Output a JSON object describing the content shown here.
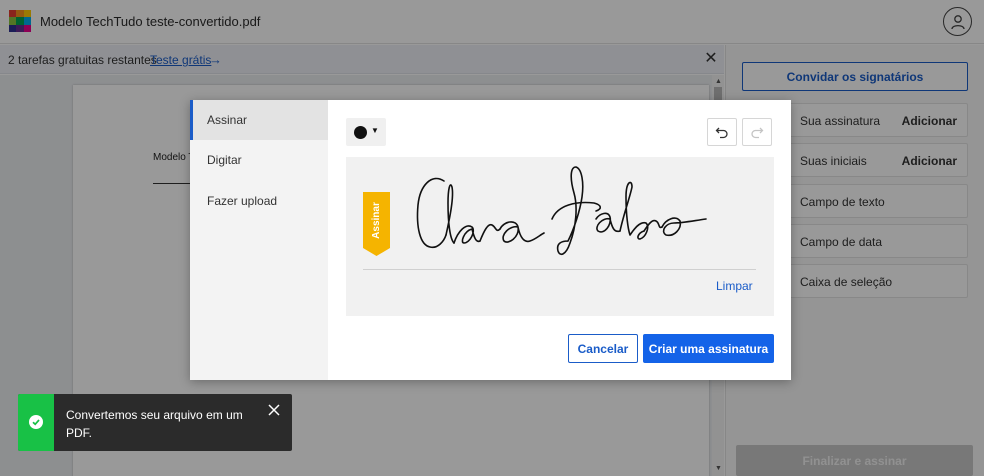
{
  "app": {
    "title": "Modelo TechTudo teste-convertido.pdf",
    "logo_colors": [
      "#e63c2f",
      "#f7941d",
      "#ffcb05",
      "#8bc53f",
      "#00a651",
      "#00aeef",
      "#2e3192",
      "#662d91",
      "#ec008c"
    ]
  },
  "infobar": {
    "tasks_text": "2 tarefas gratuitas restantes",
    "trial_link": "Teste grátis",
    "arrow": "→",
    "close": "✕"
  },
  "document": {
    "label_visible": "Modelo T"
  },
  "right_panel": {
    "invite_label": "Convidar os signatários",
    "fields": [
      {
        "label": "Sua assinatura",
        "action": "Adicionar"
      },
      {
        "label": "Suas iniciais",
        "action": "Adicionar"
      },
      {
        "label": "Campo de texto",
        "action": ""
      },
      {
        "label": "Campo de data",
        "action": ""
      },
      {
        "label": "Caixa de seleção",
        "action": ""
      }
    ],
    "finalize_label": "Finalizar e assinar"
  },
  "modal": {
    "tabs": [
      {
        "label": "Assinar",
        "active": true
      },
      {
        "label": "Digitar",
        "active": false
      },
      {
        "label": "Fazer upload",
        "active": false
      }
    ],
    "pen_color": "#111111",
    "badge_label": "Assinar",
    "badge_color": "#f5b400",
    "clear_label": "Limpar",
    "cancel_label": "Cancelar",
    "create_label": "Criar uma assinatura"
  },
  "toast": {
    "message": "Convertemos seu arquivo em um PDF.",
    "accent_color": "#18c146"
  },
  "colors": {
    "primary": "#1a5cc8",
    "primary_fill": "#1463e8"
  }
}
